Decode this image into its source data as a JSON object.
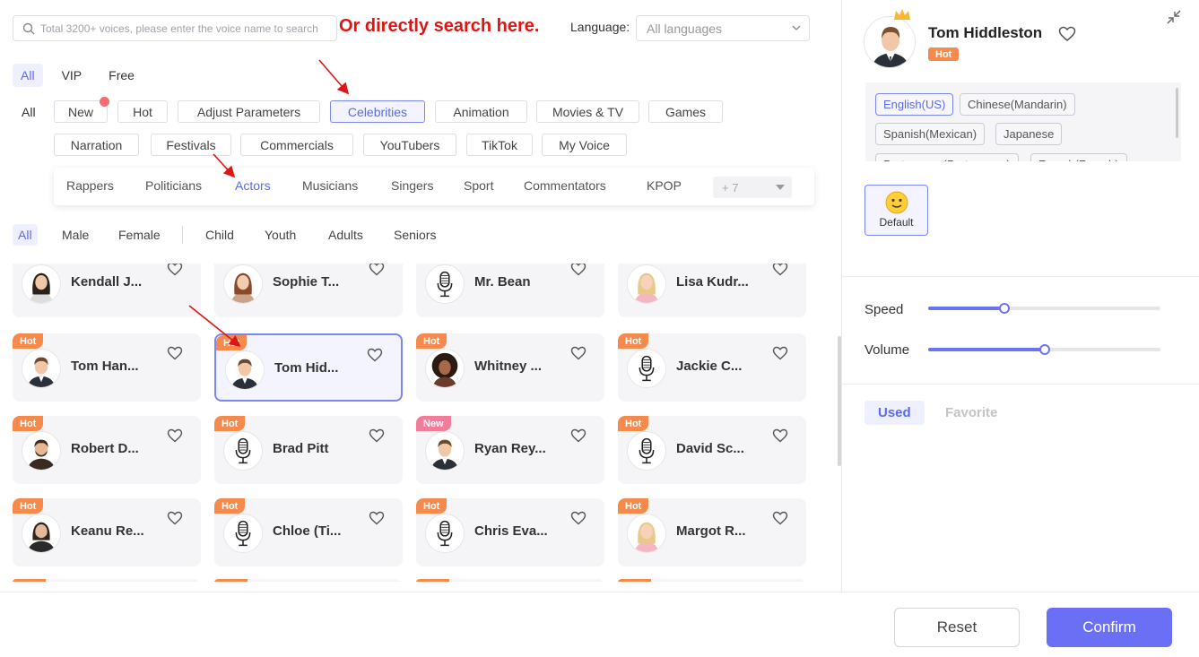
{
  "search": {
    "placeholder": "Total 3200+ voices, please enter the voice name to search"
  },
  "annotation": {
    "text": "Or directly search here."
  },
  "language": {
    "label": "Language:",
    "value": "All languages"
  },
  "tiers": [
    "All",
    "VIP",
    "Free"
  ],
  "categories": {
    "all_label": "All",
    "items": [
      "New",
      "Hot",
      "Adjust Parameters",
      "Celebrities",
      "Animation",
      "Movies & TV",
      "Games",
      "Narration",
      "Festivals",
      "Commercials",
      "YouTubers",
      "TikTok",
      "My Voice"
    ],
    "active": "Celebrities"
  },
  "subcategories": {
    "items": [
      "Rappers",
      "Politicians",
      "Actors",
      "Musicians",
      "Singers",
      "Sport",
      "Commentators",
      "KPOP"
    ],
    "active": "Actors",
    "more": "+ 7"
  },
  "filters": [
    "All",
    "Male",
    "Female",
    "Child",
    "Youth",
    "Adults",
    "Seniors"
  ],
  "voices": [
    {
      "name": "Kendall J...",
      "badge": "",
      "avatar": "woman-dark"
    },
    {
      "name": "Sophie T...",
      "badge": "",
      "avatar": "woman-auburn"
    },
    {
      "name": "Mr. Bean",
      "badge": "",
      "avatar": "microphone"
    },
    {
      "name": "Lisa Kudr...",
      "badge": "",
      "avatar": "woman-blonde"
    },
    {
      "name": "Tom Han...",
      "badge": "Hot",
      "avatar": "man-suit"
    },
    {
      "name": "Tom Hid...",
      "badge": "Hot",
      "avatar": "man-suit"
    },
    {
      "name": "Whitney ...",
      "badge": "Hot",
      "avatar": "woman-curly"
    },
    {
      "name": "Jackie C...",
      "badge": "Hot",
      "avatar": "microphone"
    },
    {
      "name": "Robert D...",
      "badge": "Hot",
      "avatar": "man-beard"
    },
    {
      "name": "Brad Pitt",
      "badge": "Hot",
      "avatar": "microphone"
    },
    {
      "name": "Ryan Rey...",
      "badge": "New",
      "avatar": "man-suit"
    },
    {
      "name": "David Sc...",
      "badge": "Hot",
      "avatar": "microphone"
    },
    {
      "name": "Keanu Re...",
      "badge": "Hot",
      "avatar": "man-long-hair"
    },
    {
      "name": "Chloe (Ti...",
      "badge": "Hot",
      "avatar": "microphone"
    },
    {
      "name": "Chris Eva...",
      "badge": "Hot",
      "avatar": "microphone"
    },
    {
      "name": "Margot R...",
      "badge": "Hot",
      "avatar": "woman-blonde"
    }
  ],
  "selected_voice": {
    "name": "Tom Hiddleston",
    "badge": "Hot",
    "languages": [
      "English(US)",
      "Chinese(Mandarin)",
      "Spanish(Mexican)",
      "Japanese",
      "Portuguese(Portuguese)",
      "French(French)"
    ],
    "style_label": "Default"
  },
  "speed": {
    "label": "Speed",
    "level": 0.33
  },
  "volume": {
    "label": "Volume",
    "level": 0.5
  },
  "panel_tabs": [
    "Used",
    "Favorite"
  ],
  "buttons": {
    "reset": "Reset",
    "confirm": "Confirm"
  },
  "colors": {
    "accent": "#6b6ff6",
    "hot": "#f58a4c",
    "new": "#f27c9a",
    "annotation": "#e01414"
  }
}
